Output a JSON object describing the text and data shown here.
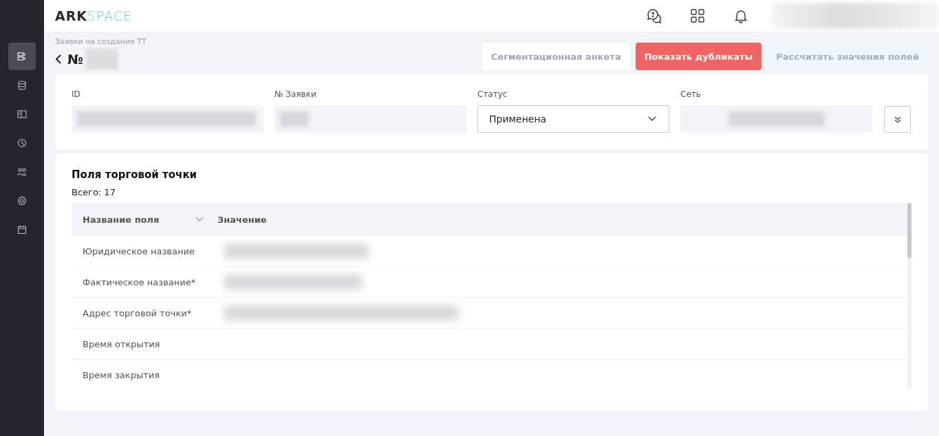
{
  "logo": {
    "part_1": "ARK",
    "part_2": "SPACE"
  },
  "sidebar": {
    "items": [
      {
        "selected": true
      },
      {
        "selected": false
      },
      {
        "selected": false
      },
      {
        "selected": false
      },
      {
        "selected": false
      },
      {
        "selected": false
      },
      {
        "selected": false
      }
    ]
  },
  "breadcrumb": "Заявки на создание ТТ",
  "title": "№",
  "actions": [
    {
      "label": "Сегментационная анкета",
      "kind": "outline"
    },
    {
      "label": "Показать дубликаты",
      "kind": "danger"
    },
    {
      "label": "Рассчитать значения полей",
      "kind": "muted"
    }
  ],
  "filters": [
    {
      "label": "ID",
      "kind": "readonly"
    },
    {
      "label": "№ Заявки",
      "kind": "readonly"
    },
    {
      "label": "Статус",
      "kind": "select",
      "value": "Применена"
    },
    {
      "label": "Сеть",
      "kind": "readonly"
    }
  ],
  "fields_panel": {
    "title": "Поля торговой точки",
    "total": "Всего: 17",
    "columns": [
      "Название поля",
      "Значение"
    ],
    "rows": [
      {
        "name": "Юридическое название"
      },
      {
        "name": "Фактическое название*"
      },
      {
        "name": "Адрес торговой точки*"
      },
      {
        "name": "Время открытия"
      },
      {
        "name": "Время закрытия"
      }
    ]
  }
}
